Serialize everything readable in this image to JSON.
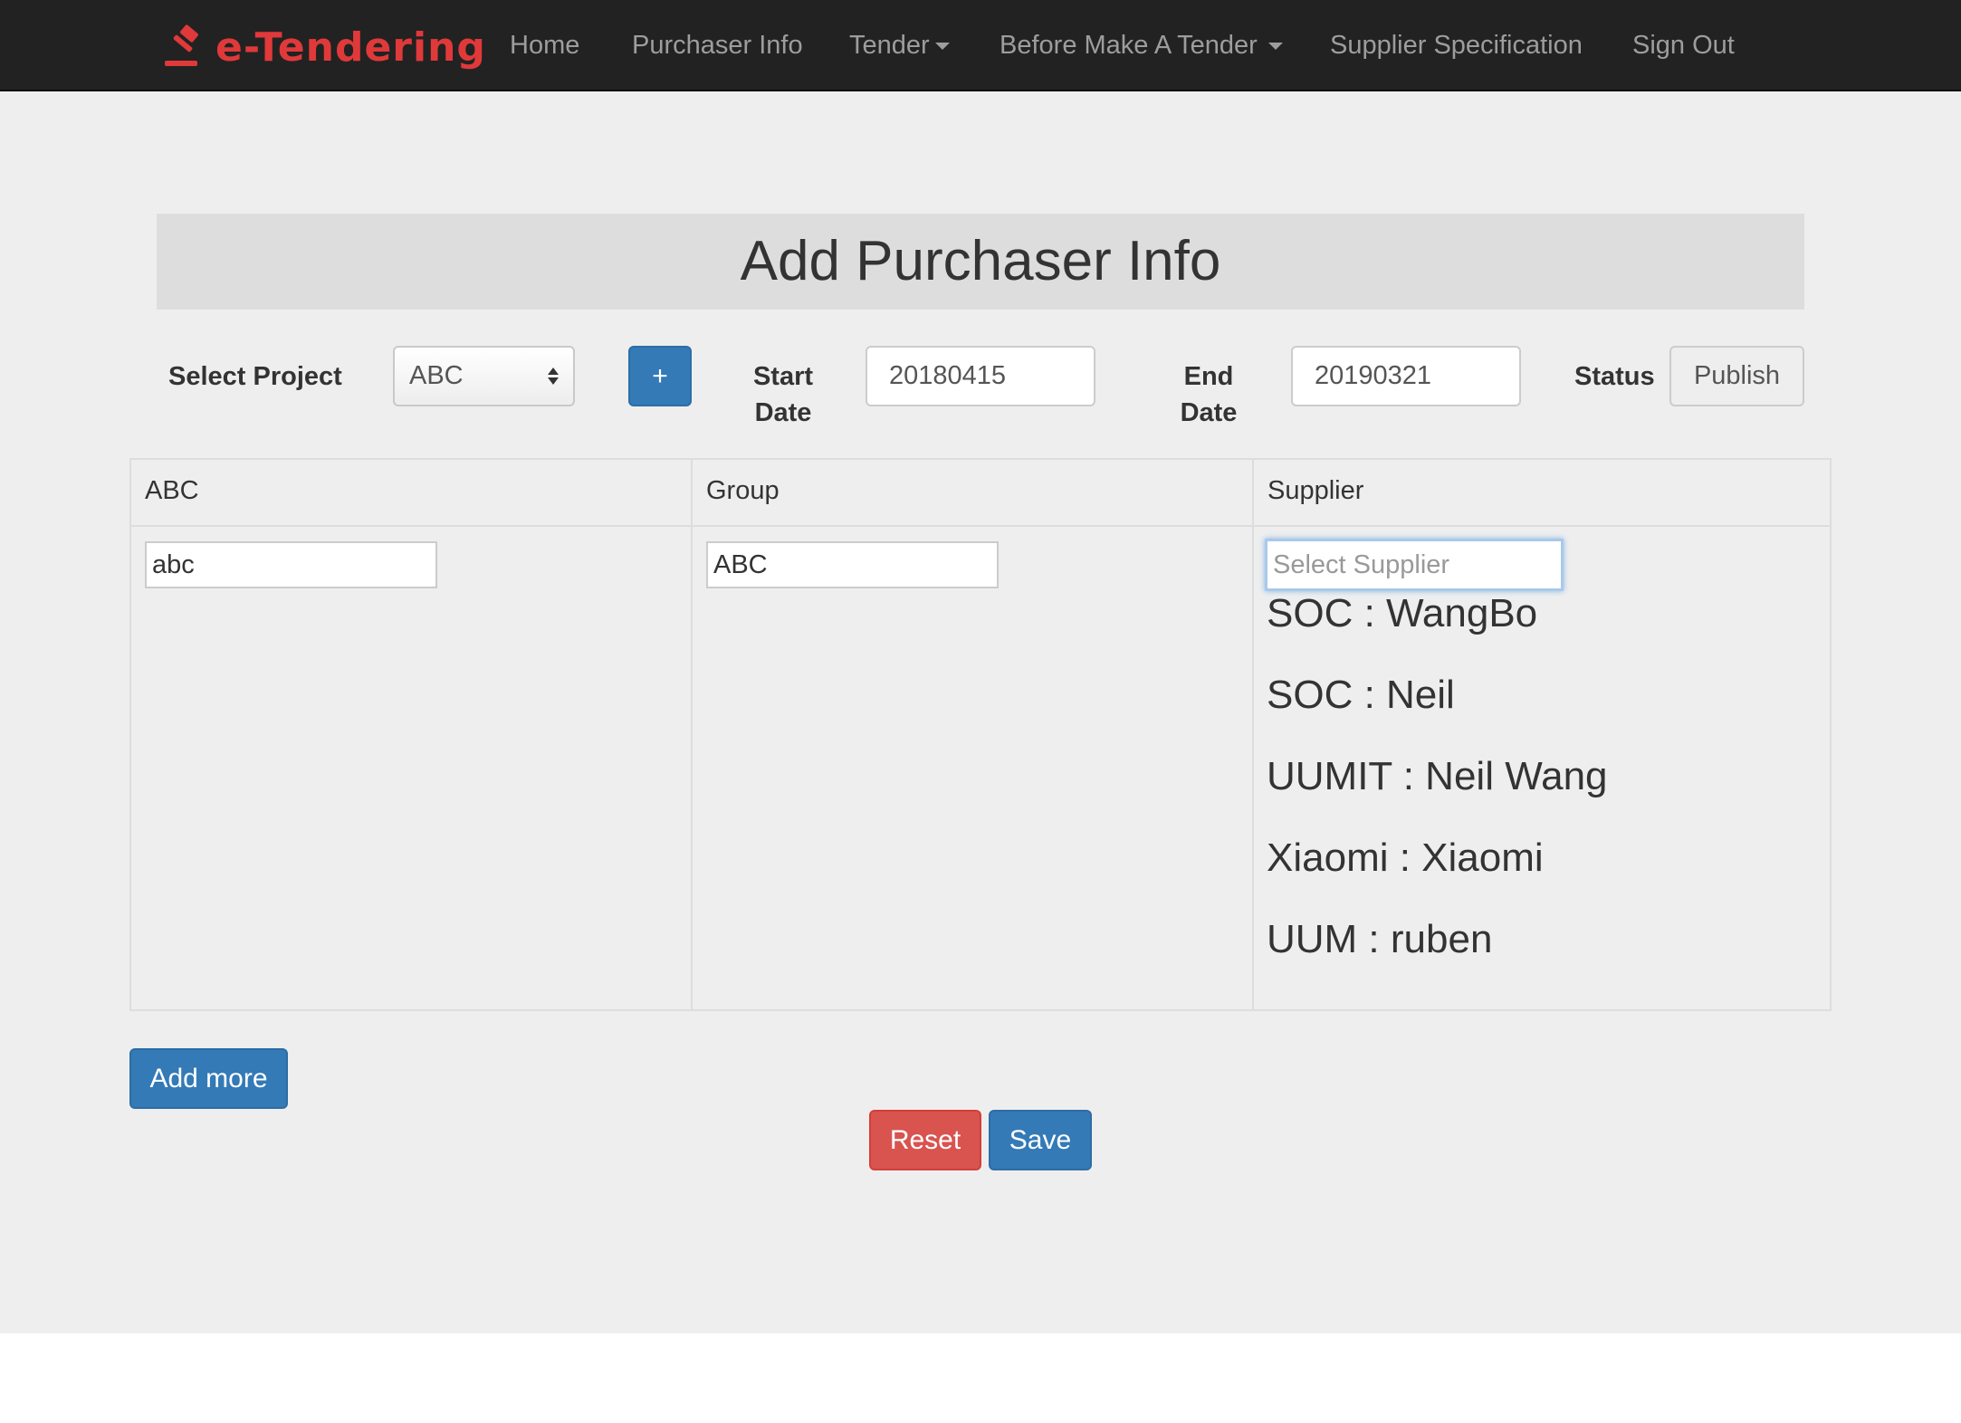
{
  "brand": {
    "text": "e-Tendering",
    "icon": "gavel-icon",
    "color": "#e0393a"
  },
  "nav": {
    "items": [
      {
        "label": "Home",
        "dropdown": false
      },
      {
        "label": "Purchaser Info",
        "dropdown": false
      },
      {
        "label": "Tender",
        "dropdown": true
      },
      {
        "label": "Before Make A Tender",
        "dropdown": true
      },
      {
        "label": "Supplier Specification",
        "dropdown": false
      },
      {
        "label": "Sign Out",
        "dropdown": false
      }
    ]
  },
  "page": {
    "title": "Add Purchaser Info"
  },
  "form": {
    "project_label": "Select Project",
    "project_value": "ABC",
    "add_project_label": "+",
    "start_label_1": "Start",
    "start_label_2": "Date",
    "start_value": "20180415",
    "end_label_1": "End",
    "end_label_2": "Date",
    "end_value": "20190321",
    "status_label": "Status",
    "status_value": "Publish"
  },
  "table": {
    "headers": [
      "ABC",
      "Group",
      "Supplier"
    ],
    "row": {
      "abc_value": "abc",
      "group_value": "ABC",
      "supplier_placeholder": "Select Supplier"
    },
    "supplier_options": [
      "SOC : WangBo",
      "SOC : Neil",
      "UUMIT : Neil Wang",
      "Xiaomi : Xiaomi",
      "UUM : ruben"
    ]
  },
  "actions": {
    "add_more": "Add more",
    "reset": "Reset",
    "save": "Save"
  },
  "colors": {
    "navbar": "#222222",
    "primary": "#337ab7",
    "danger": "#d9534f",
    "background": "#eeeeee"
  }
}
